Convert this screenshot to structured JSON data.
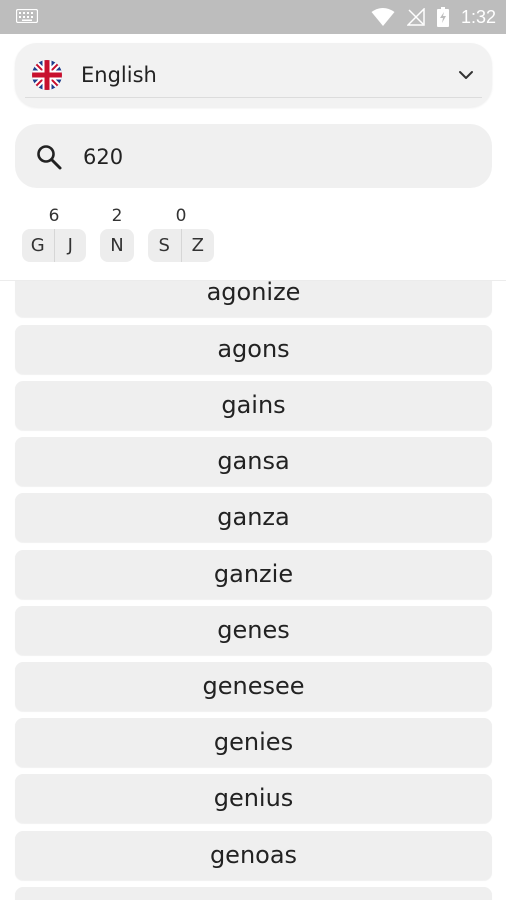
{
  "status_bar": {
    "time": "1:32",
    "background": "#bdbdbd"
  },
  "language": {
    "label": "English"
  },
  "search": {
    "value": "620"
  },
  "key_groups": [
    {
      "count": "6",
      "letters": [
        "G",
        "J"
      ]
    },
    {
      "count": "2",
      "letters": [
        "N"
      ]
    },
    {
      "count": "0",
      "letters": [
        "S",
        "Z"
      ]
    }
  ],
  "words": [
    "agonize",
    "agons",
    "gains",
    "gansa",
    "ganza",
    "ganzie",
    "genes",
    "genesee",
    "genies",
    "genius",
    "genoas",
    ""
  ]
}
